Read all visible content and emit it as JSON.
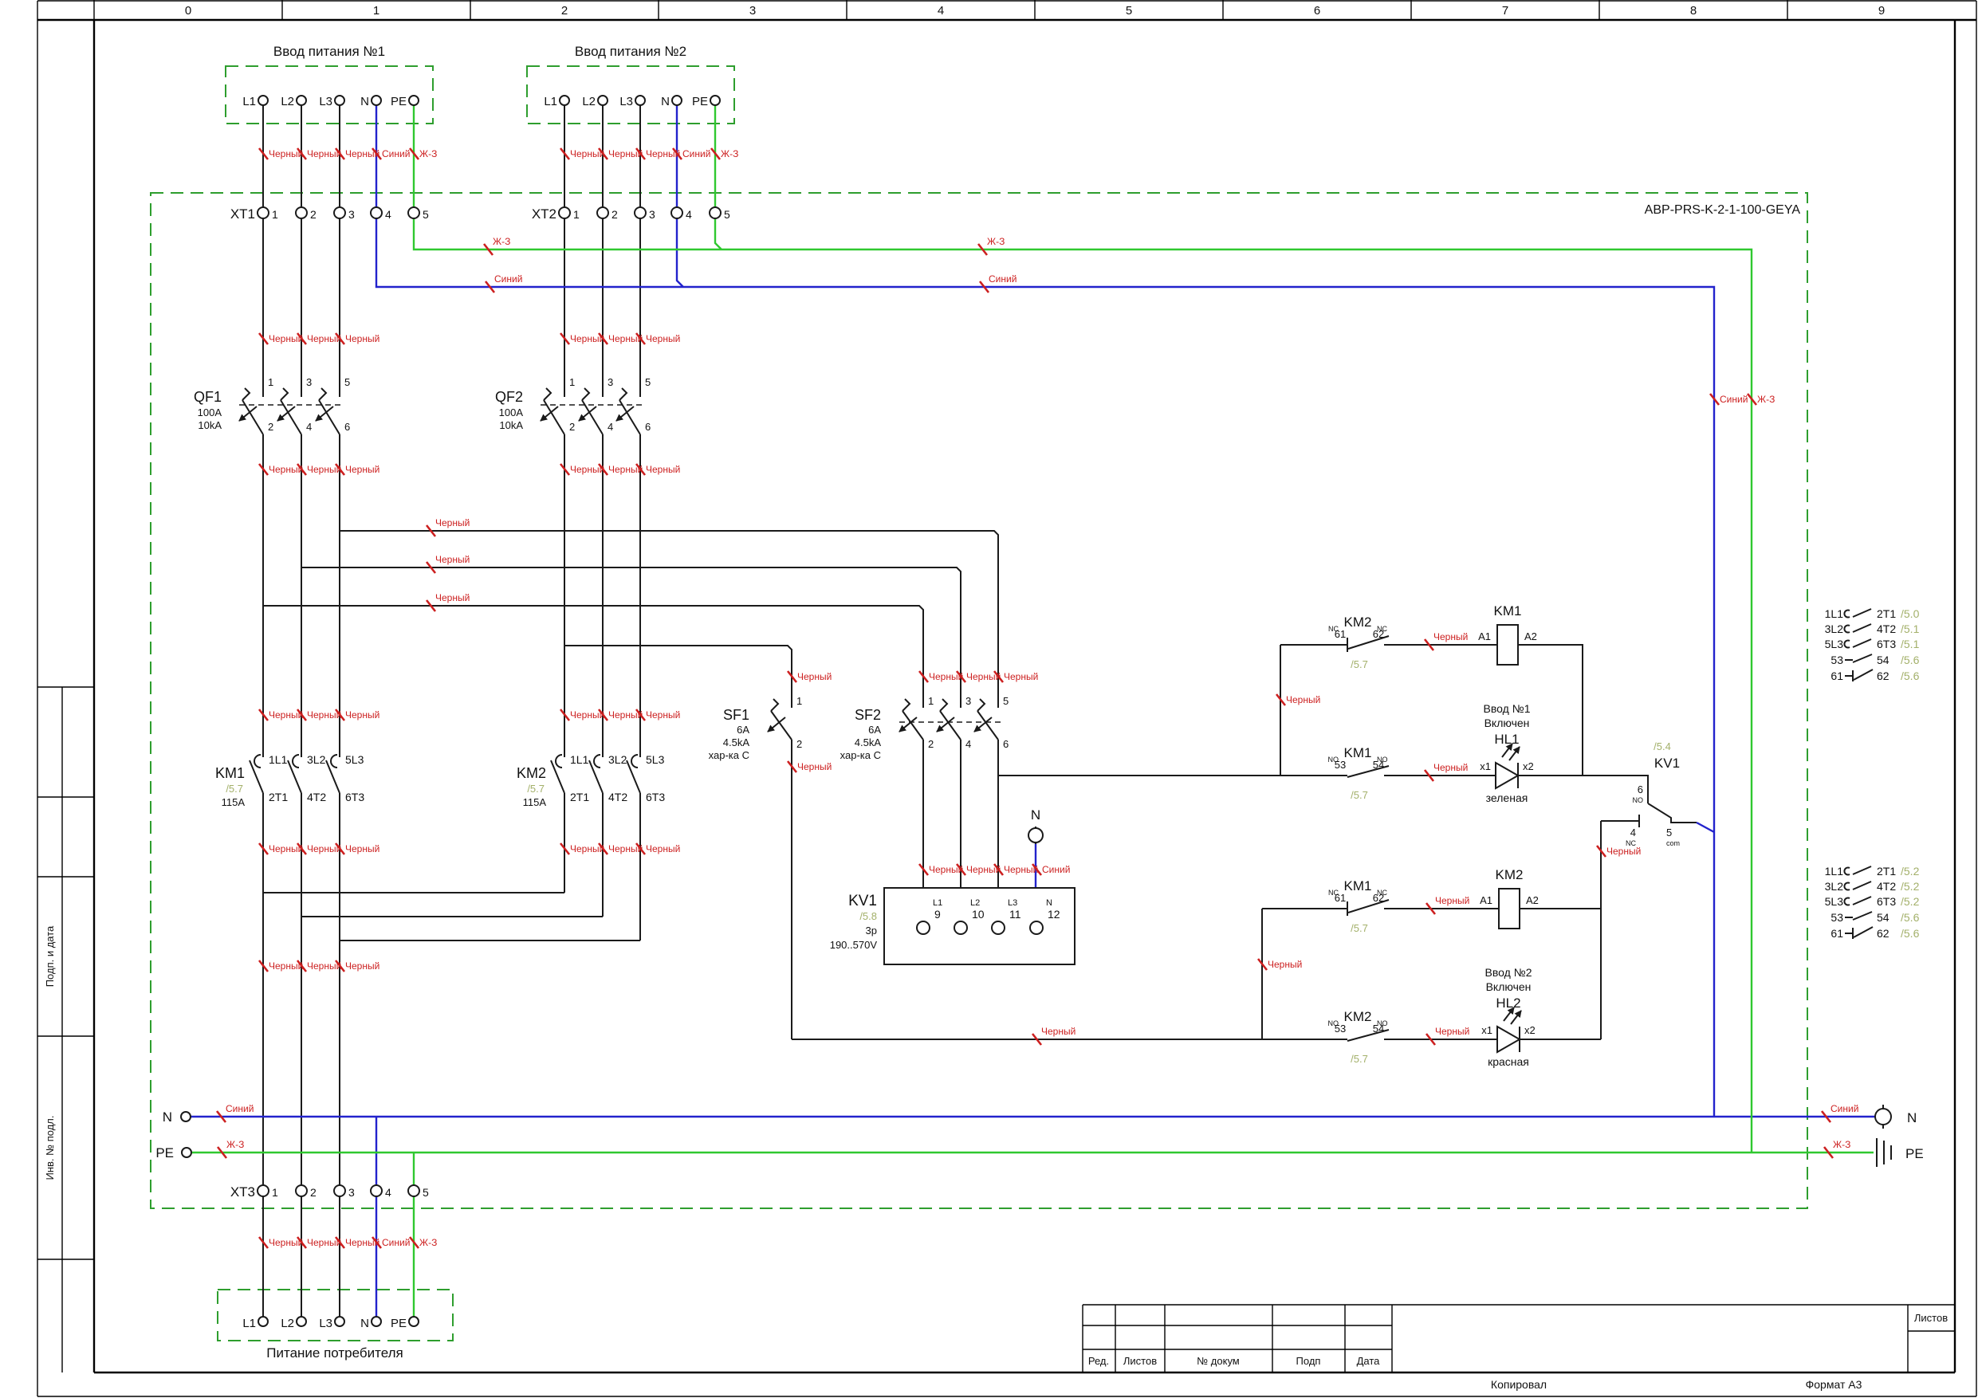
{
  "ruler": {
    "zones": [
      "0",
      "1",
      "2",
      "3",
      "4",
      "5",
      "6",
      "7",
      "8",
      "9"
    ]
  },
  "wire": {
    "black": "Черный",
    "blue": "Синий",
    "yg": "Ж-З"
  },
  "panel": {
    "model": "ABP-PRS-K-2-1-100-GEYA"
  },
  "inputs": {
    "input1_title": "Ввод питания №1",
    "input2_title": "Ввод питания №2",
    "consumer_title": "Питание потребителя",
    "terminals": [
      "L1",
      "L2",
      "L3",
      "N",
      "PE"
    ]
  },
  "blocks": {
    "xt1": "XT1",
    "xt2": "XT2",
    "xt3": "XT3",
    "numbers": [
      "1",
      "2",
      "3",
      "4",
      "5"
    ]
  },
  "poles": {
    "top": [
      "1",
      "3",
      "5"
    ],
    "bottom": [
      "2",
      "4",
      "6"
    ]
  },
  "qf1": {
    "name": "QF1",
    "current": "100A",
    "icu": "10kA"
  },
  "qf2": {
    "name": "QF2",
    "current": "100A",
    "icu": "10kA"
  },
  "sf1": {
    "name": "SF1",
    "current": "6A",
    "icu": "4.5kA",
    "curve": "хар-ка C"
  },
  "sf2": {
    "name": "SF2",
    "current": "6A",
    "icu": "4.5kA",
    "curve": "хар-ка C"
  },
  "km_main": {
    "top": [
      "1L1",
      "3L2",
      "5L3"
    ],
    "bottom": [
      "2T1",
      "4T2",
      "6T3"
    ]
  },
  "km1": {
    "name": "KM1",
    "ref": "/5.7",
    "current": "115A"
  },
  "km2": {
    "name": "KM2",
    "ref": "/5.7",
    "current": "115A"
  },
  "kv1": {
    "name": "KV1",
    "ref": "/5.8",
    "poles": "3p",
    "range": "190..570V",
    "terms": [
      {
        "line": "L1",
        "num": "9"
      },
      {
        "line": "L2",
        "num": "10"
      },
      {
        "line": "L3",
        "num": "11"
      },
      {
        "line": "N",
        "num": "12"
      }
    ]
  },
  "n_node": "N",
  "control": {
    "nc": "NC",
    "no": "NO",
    "c1": {
      "int_name": "KM2",
      "int_a": "61",
      "int_b": "62",
      "int_ref": "/5.7",
      "coil_name": "KM1",
      "a1": "A1",
      "a2": "A2",
      "aux_name": "KM1",
      "aux_a": "53",
      "aux_b": "54",
      "aux_ref": "/5.7",
      "lamp_l1": "Ввод №1",
      "lamp_l2": "Включен",
      "lamp_name": "HL1",
      "x1": "x1",
      "x2": "x2",
      "lamp_color": "зеленая"
    },
    "c2": {
      "int_name": "KM1",
      "int_a": "61",
      "int_b": "62",
      "int_ref": "/5.7",
      "coil_name": "KM2",
      "a1": "A1",
      "a2": "A2",
      "aux_name": "KM2",
      "aux_a": "53",
      "aux_b": "54",
      "aux_ref": "/5.7",
      "lamp_l1": "Ввод №2",
      "lamp_l2": "Включен",
      "lamp_name": "HL2",
      "x1": "x1",
      "x2": "x2",
      "lamp_color": "красная"
    },
    "kv": {
      "ref": "/5.4",
      "name": "KV1",
      "no_num": "6",
      "no_lbl": "NO",
      "nc_num": "4",
      "nc_lbl": "NC",
      "com_num": "5",
      "com_lbl": "com"
    }
  },
  "crossref": {
    "km1_rows": [
      {
        "l": "1L1",
        "r": "2T1",
        "ref": "/5.0"
      },
      {
        "l": "3L2",
        "r": "4T2",
        "ref": "/5.1"
      },
      {
        "l": "5L3",
        "r": "6T3",
        "ref": "/5.1"
      },
      {
        "l": "53",
        "r": "54",
        "ref": "/5.6"
      },
      {
        "l": "61",
        "r": "62",
        "ref": "/5.6"
      }
    ],
    "km2_rows": [
      {
        "l": "1L1",
        "r": "2T1",
        "ref": "/5.2"
      },
      {
        "l": "3L2",
        "r": "4T2",
        "ref": "/5.2"
      },
      {
        "l": "5L3",
        "r": "6T3",
        "ref": "/5.2"
      },
      {
        "l": "53",
        "r": "54",
        "ref": "/5.6"
      },
      {
        "l": "61",
        "r": "62",
        "ref": "/5.6"
      }
    ]
  },
  "bus": {
    "n": "N",
    "pe": "PE"
  },
  "titleblock": {
    "red": "Ред.",
    "listy": "Листов",
    "doc": "№ докум",
    "podp": "Подп",
    "date": "Дата",
    "listov": "Листов",
    "copied": "Копировал",
    "format": "Формат А3"
  },
  "margin": {
    "podp": "Подп. и дата",
    "inv": "Инв. № подл."
  }
}
